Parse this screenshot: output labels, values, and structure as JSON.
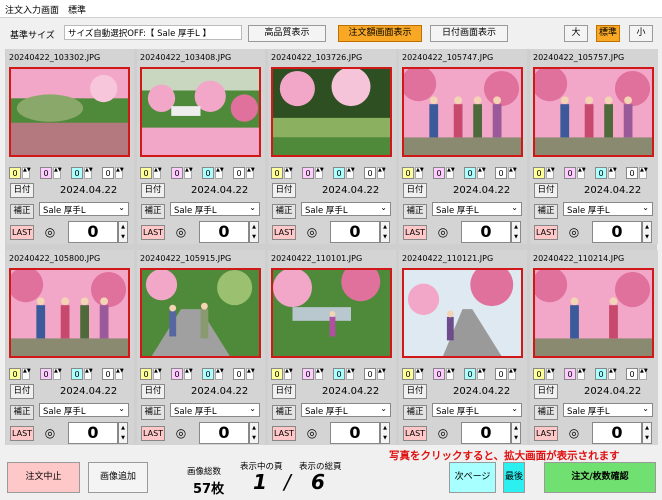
{
  "window": {
    "title": "注文入力画面　標準"
  },
  "toolbar": {
    "base_size_label": "基準サイズ",
    "size_text": "サイズ自動選択OFF:【 Sale 厚手L 】",
    "hq_btn": "高品質表示",
    "order_view_btn": "注文額画面表示",
    "date_view_btn": "日付画面表示",
    "size_large": "大",
    "size_std": "標準",
    "size_small": "小"
  },
  "cards": [
    {
      "fname": "20240422_103302.JPG",
      "date": "2024.04.22",
      "paper": "Sale 厚手L",
      "count": "0",
      "q": [
        "0",
        "0",
        "0",
        "0"
      ],
      "scene": "landscape1"
    },
    {
      "fname": "20240422_103408.JPG",
      "date": "2024.04.22",
      "paper": "Sale 厚手L",
      "count": "0",
      "q": [
        "0",
        "0",
        "0",
        "0"
      ],
      "scene": "landscape2"
    },
    {
      "fname": "20240422_103726.JPG",
      "date": "2024.04.22",
      "paper": "Sale 厚手L",
      "count": "0",
      "q": [
        "0",
        "0",
        "0",
        "0"
      ],
      "scene": "landscape3"
    },
    {
      "fname": "20240422_105747.JPG",
      "date": "2024.04.22",
      "paper": "Sale 厚手L",
      "count": "0",
      "q": [
        "0",
        "0",
        "0",
        "0"
      ],
      "scene": "people"
    },
    {
      "fname": "20240422_105757.JPG",
      "date": "2024.04.22",
      "paper": "Sale 厚手L",
      "count": "0",
      "q": [
        "0",
        "0",
        "0",
        "0"
      ],
      "scene": "people"
    },
    {
      "fname": "20240422_105800.JPG",
      "date": "2024.04.22",
      "paper": "Sale 厚手L",
      "count": "0",
      "q": [
        "0",
        "0",
        "0",
        "0"
      ],
      "scene": "people"
    },
    {
      "fname": "20240422_105915.JPG",
      "date": "2024.04.22",
      "paper": "Sale 厚手L",
      "count": "0",
      "q": [
        "0",
        "0",
        "0",
        "0"
      ],
      "scene": "path"
    },
    {
      "fname": "20240422_110101.JPG",
      "date": "2024.04.22",
      "paper": "Sale 厚手L",
      "count": "0",
      "q": [
        "0",
        "0",
        "0",
        "0"
      ],
      "scene": "river"
    },
    {
      "fname": "20240422_110121.JPG",
      "date": "2024.04.22",
      "paper": "Sale 厚手L",
      "count": "0",
      "q": [
        "0",
        "0",
        "0",
        "0"
      ],
      "scene": "road"
    },
    {
      "fname": "20240422_110214.JPG",
      "date": "2024.04.22",
      "paper": "Sale 厚手L",
      "count": "0",
      "q": [
        "0",
        "0",
        "0",
        "0"
      ],
      "scene": "people2"
    }
  ],
  "card_labels": {
    "date_btn": "日付",
    "hosei_btn": "補正",
    "last_btn": "LAST",
    "eye": "◎"
  },
  "footer": {
    "cancel": "注文中止",
    "add": "画像追加",
    "total_label": "画像総数",
    "total_value": "57枚",
    "page_label": "表示中の頁",
    "page_value": "1",
    "slash": "/",
    "max_label": "表示の総頁",
    "max_value": "6",
    "notice": "写真をクリックすると、拡大画面が表示されます",
    "next": "次ページ",
    "last": "最後",
    "confirm": "注文/枚数確認"
  },
  "colors": {
    "accent_orange": "#f8a825",
    "cancel_pink": "#ffc8c8",
    "next_cyan": "#a8ffff",
    "last_cyan": "#2cf0f0",
    "confirm_green": "#70e070",
    "notice_red": "#e01010",
    "photo_border": "#d01818"
  }
}
